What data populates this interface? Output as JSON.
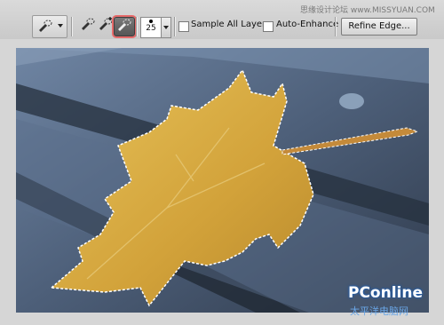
{
  "watermark": {
    "top_text": "思缘设计论坛 www.MISSYUAN.COM",
    "brand": "PConline",
    "brand_sub": "太平洋电脑网"
  },
  "toolbar": {
    "brush_size": "25",
    "sample_all_layers_label": "Sample All Layers",
    "sample_all_layers_checked": false,
    "auto_enhance_label": "Auto-Enhance",
    "auto_enhance_checked": false,
    "refine_edge_label": "Refine Edge...",
    "icons": [
      "quick-selection-icon",
      "new-selection-icon",
      "add-to-selection-icon",
      "subtract-from-selection-icon"
    ]
  },
  "canvas": {
    "colors": {
      "wood": "#4d5f79",
      "leaf": "#d4a63c",
      "selection": "#ffffff"
    }
  }
}
